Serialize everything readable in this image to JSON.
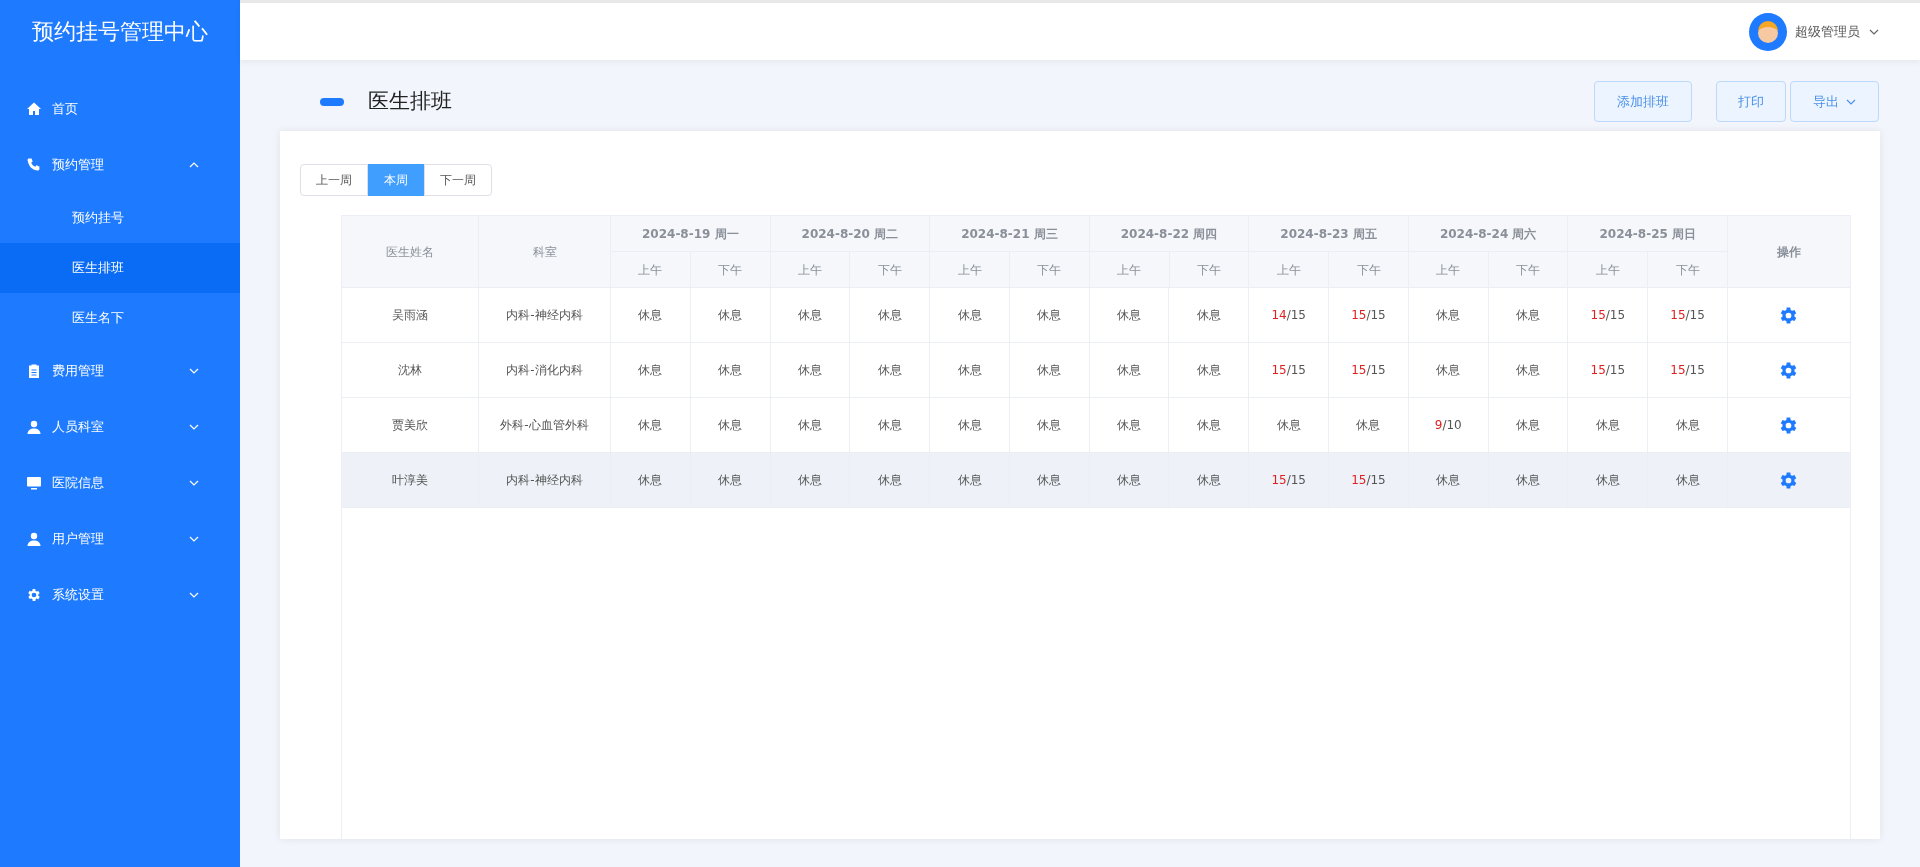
{
  "sidebar": {
    "title": "预约挂号管理中心",
    "items": [
      {
        "label": "首页"
      },
      {
        "label": "预约管理",
        "expanded": true,
        "children": [
          {
            "label": "预约挂号",
            "selected": false
          },
          {
            "label": "医生排班",
            "selected": true
          },
          {
            "label": "医生名下",
            "selected": false
          }
        ]
      },
      {
        "label": "费用管理",
        "expanded": false
      },
      {
        "label": "人员科室",
        "expanded": false
      },
      {
        "label": "医院信息",
        "expanded": false
      },
      {
        "label": "用户管理",
        "expanded": false
      },
      {
        "label": "系统设置",
        "expanded": false
      }
    ]
  },
  "header": {
    "user": "超级管理员"
  },
  "page": {
    "title": "医生排班",
    "actions": [
      {
        "label": "添加排班",
        "kind": "button"
      },
      {
        "label": "打印",
        "kind": "button"
      },
      {
        "label": "导出",
        "kind": "dropdown"
      }
    ]
  },
  "week_tabs": [
    {
      "label": "上一周",
      "selected": false
    },
    {
      "label": "本周",
      "selected": true
    },
    {
      "label": "下一周",
      "selected": false
    }
  ],
  "table": {
    "name_header": "医生姓名",
    "dept_header": "科室",
    "action_header": "操作",
    "days": [
      {
        "label": "2024-8-19 周一",
        "halves": [
          "上午",
          "下午"
        ]
      },
      {
        "label": "2024-8-20 周二",
        "halves": [
          "上午",
          "下午"
        ]
      },
      {
        "label": "2024-8-21 周三",
        "halves": [
          "上午",
          "下午"
        ]
      },
      {
        "label": "2024-8-22 周四",
        "halves": [
          "上午",
          "下午"
        ]
      },
      {
        "label": "2024-8-23 周五",
        "halves": [
          "上午",
          "下午"
        ]
      },
      {
        "label": "2024-8-24 周六",
        "halves": [
          "上午",
          "下午"
        ]
      },
      {
        "label": "2024-8-25 周日",
        "halves": [
          "上午",
          "下午"
        ]
      }
    ],
    "rows": [
      {
        "name": "吴雨涵",
        "dept": "内科-神经内科",
        "highlighted": false,
        "cells": [
          {
            "kind": "rest",
            "text": "休息"
          },
          {
            "kind": "rest",
            "text": "休息"
          },
          {
            "kind": "rest",
            "text": "休息"
          },
          {
            "kind": "rest",
            "text": "休息"
          },
          {
            "kind": "rest",
            "text": "休息"
          },
          {
            "kind": "rest",
            "text": "休息"
          },
          {
            "kind": "rest",
            "text": "休息"
          },
          {
            "kind": "rest",
            "text": "休息"
          },
          {
            "kind": "slots",
            "used": "14",
            "total": "/15"
          },
          {
            "kind": "slots",
            "used": "15",
            "total": "/15"
          },
          {
            "kind": "rest",
            "text": "休息"
          },
          {
            "kind": "rest",
            "text": "休息"
          },
          {
            "kind": "slots",
            "used": "15",
            "total": "/15"
          },
          {
            "kind": "slots",
            "used": "15",
            "total": "/15"
          }
        ]
      },
      {
        "name": "沈林",
        "dept": "内科-消化内科",
        "highlighted": false,
        "cells": [
          {
            "kind": "rest",
            "text": "休息"
          },
          {
            "kind": "rest",
            "text": "休息"
          },
          {
            "kind": "rest",
            "text": "休息"
          },
          {
            "kind": "rest",
            "text": "休息"
          },
          {
            "kind": "rest",
            "text": "休息"
          },
          {
            "kind": "rest",
            "text": "休息"
          },
          {
            "kind": "rest",
            "text": "休息"
          },
          {
            "kind": "rest",
            "text": "休息"
          },
          {
            "kind": "slots",
            "used": "15",
            "total": "/15"
          },
          {
            "kind": "slots",
            "used": "15",
            "total": "/15"
          },
          {
            "kind": "rest",
            "text": "休息"
          },
          {
            "kind": "rest",
            "text": "休息"
          },
          {
            "kind": "slots",
            "used": "15",
            "total": "/15"
          },
          {
            "kind": "slots",
            "used": "15",
            "total": "/15"
          }
        ]
      },
      {
        "name": "贾美欣",
        "dept": "外科-心血管外科",
        "highlighted": false,
        "cells": [
          {
            "kind": "rest",
            "text": "休息"
          },
          {
            "kind": "rest",
            "text": "休息"
          },
          {
            "kind": "rest",
            "text": "休息"
          },
          {
            "kind": "rest",
            "text": "休息"
          },
          {
            "kind": "rest",
            "text": "休息"
          },
          {
            "kind": "rest",
            "text": "休息"
          },
          {
            "kind": "rest",
            "text": "休息"
          },
          {
            "kind": "rest",
            "text": "休息"
          },
          {
            "kind": "rest",
            "text": "休息"
          },
          {
            "kind": "rest",
            "text": "休息"
          },
          {
            "kind": "slots",
            "used": "9",
            "total": "/10"
          },
          {
            "kind": "rest",
            "text": "休息"
          },
          {
            "kind": "rest",
            "text": "休息"
          },
          {
            "kind": "rest",
            "text": "休息"
          }
        ]
      },
      {
        "name": "叶淳美",
        "dept": "内科-神经内科",
        "highlighted": true,
        "cells": [
          {
            "kind": "rest",
            "text": "休息"
          },
          {
            "kind": "rest",
            "text": "休息"
          },
          {
            "kind": "rest",
            "text": "休息"
          },
          {
            "kind": "rest",
            "text": "休息"
          },
          {
            "kind": "rest",
            "text": "休息"
          },
          {
            "kind": "rest",
            "text": "休息"
          },
          {
            "kind": "rest",
            "text": "休息"
          },
          {
            "kind": "rest",
            "text": "休息"
          },
          {
            "kind": "slots",
            "used": "15",
            "total": "/15"
          },
          {
            "kind": "slots",
            "used": "15",
            "total": "/15"
          },
          {
            "kind": "rest",
            "text": "休息"
          },
          {
            "kind": "rest",
            "text": "休息"
          },
          {
            "kind": "rest",
            "text": "休息"
          },
          {
            "kind": "rest",
            "text": "休息"
          }
        ]
      }
    ]
  }
}
